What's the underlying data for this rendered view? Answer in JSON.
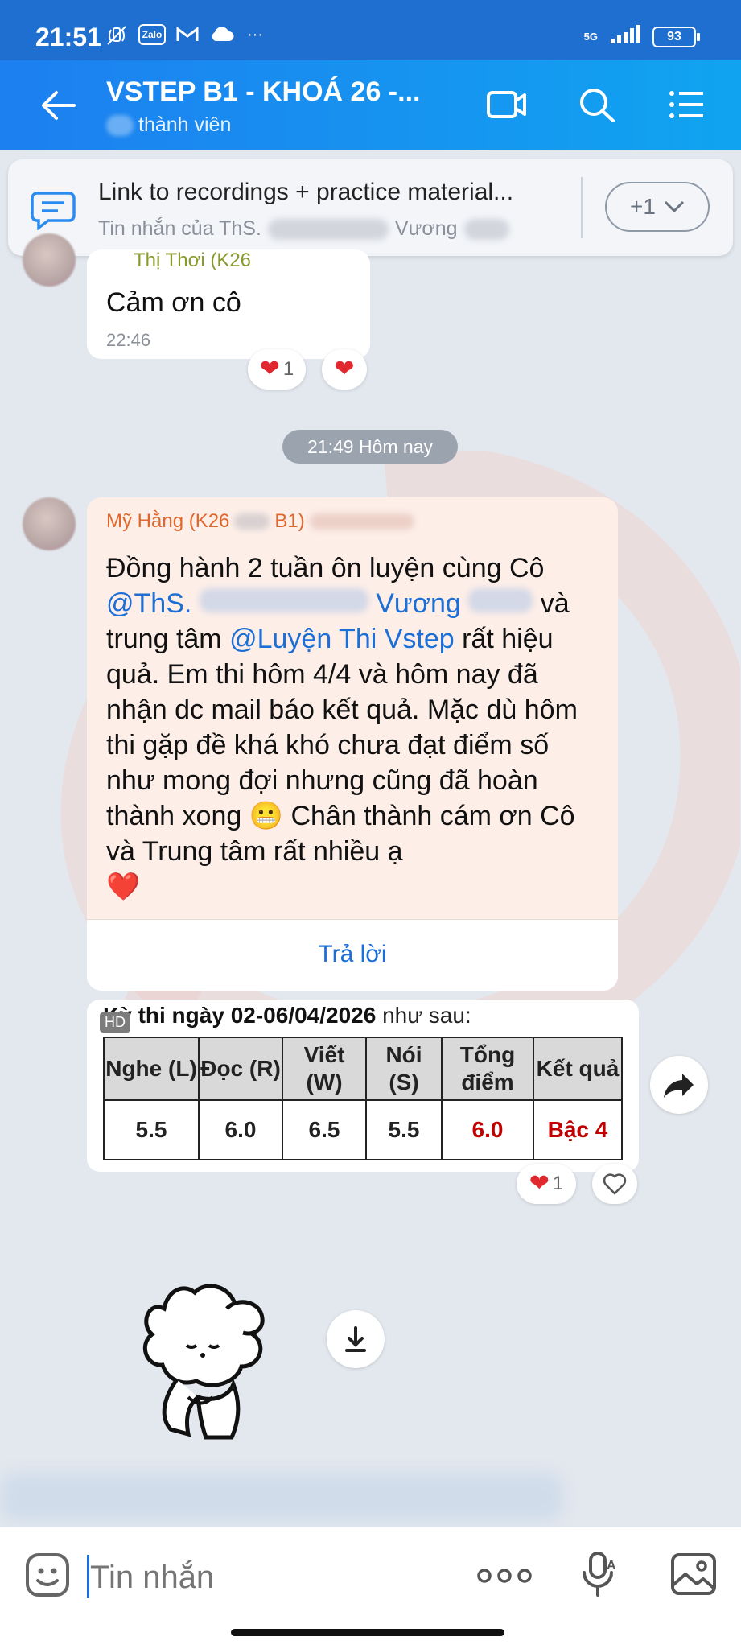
{
  "status_bar": {
    "time": "21:51",
    "zalo_label": "Zalo",
    "more_label": "···",
    "network": "5G",
    "battery": "93"
  },
  "header": {
    "title": "VSTEP B1 - KHOÁ 26 -...",
    "subtitle": "thành viên"
  },
  "pinned": {
    "title": "Link to recordings + practice material...",
    "subtitle_prefix": "Tin nhắn của ThS.",
    "subtitle_suffix": "Vương",
    "more_label": "+1"
  },
  "message1": {
    "sender": "Thị Thơi (K26",
    "text": "Cảm ơn cô",
    "time": "22:46",
    "reaction_count": "1",
    "heart": "❤"
  },
  "date_divider": "21:49 Hôm nay",
  "message2": {
    "sender_a": "Mỹ Hằng (K26",
    "sender_b": "B1)",
    "text_1": "Đồng hành 2 tuần ôn luyện cùng Cô",
    "mention_1a": "@ThS.",
    "mention_1b": "Vương",
    "text_2": " và",
    "text_3": "trung tâm ",
    "mention_2": "@Luyện Thi Vstep",
    "text_4": " rất hiệu quả. Em thi hôm 4/4 và hôm nay đã nhận dc mail báo kết quả. Mặc dù hôm thi gặp đề khá khó chưa đạt điểm số như mong đợi nhưng cũng đã hoàn thành xong 😬 Chân thành cám ơn Cô và Trung tâm rất nhiều ạ",
    "heart": "❤️",
    "reply_label": "Trả lời"
  },
  "result_card": {
    "caption_prefix": "Kỳ thi ngày ",
    "caption_date": "02-06/04/2026",
    "caption_suffix": " như sau:",
    "hd_label": "HD",
    "headers": [
      "Nghe (L)",
      "Đọc (R)",
      "Viết (W)",
      "Nói (S)",
      "Tổng điểm",
      "Kết quả"
    ],
    "values": [
      "5.5",
      "6.0",
      "6.5",
      "5.5",
      "6.0",
      "Bậc 4"
    ],
    "reaction_count": "1"
  },
  "input": {
    "placeholder": "Tin nhắn"
  },
  "colors": {
    "header_start": "#1d7ff0",
    "header_end": "#10a4f0",
    "mention": "#1b6fd6",
    "highlight_bubble": "#fdeee8",
    "result_red": "#c00000"
  }
}
